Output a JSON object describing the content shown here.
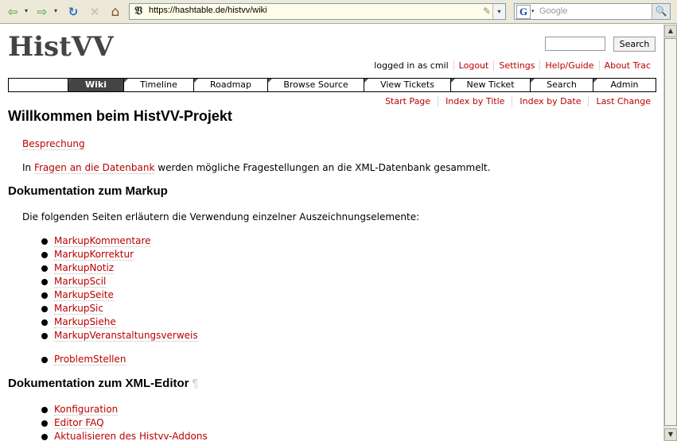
{
  "browser": {
    "url": "https://hashtable.de/histvv/wiki",
    "search_placeholder": "Google",
    "search_engine_letter": "G",
    "favicon_glyph": "𝔙",
    "buttons": {
      "back": "⇦",
      "forward": "⇨",
      "reload": "↻",
      "stop": "✕",
      "home": "⌂",
      "dropdown": "▾",
      "search": "🔍"
    }
  },
  "site": {
    "logo": "HistVV",
    "search_button": "Search"
  },
  "metanav": {
    "logged_in": "logged in as cmil",
    "links": [
      "Logout",
      "Settings",
      "Help/Guide",
      "About Trac"
    ]
  },
  "mainnav": {
    "items": [
      "Wiki",
      "Timeline",
      "Roadmap",
      "Browse Source",
      "View Tickets",
      "New Ticket",
      "Search",
      "Admin"
    ],
    "active": "Wiki"
  },
  "ctxnav": {
    "links": [
      "Start Page",
      "Index by Title",
      "Index by Date",
      "Last Change"
    ]
  },
  "page": {
    "title": "Willkommen beim HistVV-Projekt",
    "besprechung": "Besprechung",
    "intro_prefix": "In ",
    "intro_link": "Fragen an die Datenbank",
    "intro_suffix": " werden mögliche Fragestellungen an die XML-Datenbank gesammelt.",
    "section1": "Dokumentation zum Markup",
    "section1_text": "Die folgenden Seiten erläutern die Verwendung einzelner Auszeichnungselemente:",
    "markup_links": [
      "MarkupKommentare",
      "MarkupKorrektur",
      "MarkupNotiz",
      "MarkupScil",
      "MarkupSeite",
      "MarkupSic",
      "MarkupSiehe",
      "MarkupVeranstaltungsverweis"
    ],
    "problem_link": "ProblemStellen",
    "section2": "Dokumentation zum XML-Editor",
    "pilcrow": "¶",
    "editor_links": [
      "Konfiguration",
      "Editor FAQ",
      "Aktualisieren des Histvv-Addons"
    ]
  }
}
